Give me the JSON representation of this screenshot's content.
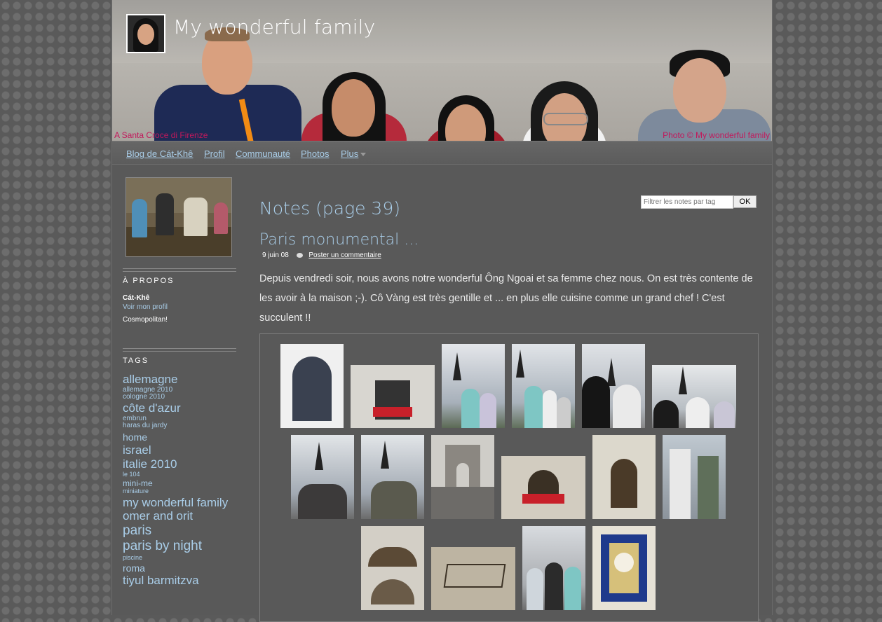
{
  "header": {
    "site_title": "My wonderful family",
    "caption_left": "A Santa Croce di Firenze",
    "caption_right": "Photo © My wonderful family"
  },
  "nav": {
    "items": [
      {
        "label": "Blog de Cát-Khê"
      },
      {
        "label": "Profil"
      },
      {
        "label": "Communauté"
      },
      {
        "label": "Photos"
      },
      {
        "label": "Plus"
      }
    ]
  },
  "sidebar": {
    "about_heading": "À PROPOS",
    "profile_name": "Cát-Khê",
    "profile_link": "Voir mon profil",
    "profile_status": "Cosmopolitan!",
    "tags_heading": "TAGS",
    "tags": [
      {
        "label": "allemagne",
        "size": "large"
      },
      {
        "label": "allemagne 2010",
        "size": "small"
      },
      {
        "label": "cologne 2010",
        "size": "small"
      },
      {
        "label": "côte d'azur",
        "size": "large"
      },
      {
        "label": "embrun",
        "size": "small"
      },
      {
        "label": "haras du jardy",
        "size": "small"
      },
      {
        "label": "home",
        "size": "medium"
      },
      {
        "label": "israel",
        "size": "large"
      },
      {
        "label": "italie 2010",
        "size": "large"
      },
      {
        "label": "le 104",
        "size": "tiny"
      },
      {
        "label": "mini-me",
        "size": "small-medium"
      },
      {
        "label": "miniature",
        "size": "tiny"
      },
      {
        "label": "my wonderful family",
        "size": "large"
      },
      {
        "label": "omer and orit",
        "size": "large"
      },
      {
        "label": "paris",
        "size": "xlarge"
      },
      {
        "label": "paris by night",
        "size": "xlarge"
      },
      {
        "label": "piscine",
        "size": "tiny"
      },
      {
        "label": "roma",
        "size": "medium"
      },
      {
        "label": "tiyul barmitzva",
        "size": "large"
      }
    ]
  },
  "main": {
    "heading": "Notes (page 39)",
    "filter_placeholder": "Filtrer les notes par tag",
    "ok_label": "OK",
    "post": {
      "title": "Paris monumental ...",
      "date": "9 juin 08",
      "comment_link": "Poster un commentaire",
      "body": "Depuis vendredi soir, nous avons notre wonderful Ông Ngoai et sa femme chez nous. On est très contente de les avoir à la maison ;-). Cô Vàng est très gentille et ... en plus elle cuisine comme un grand chef ! C'est succulent !!"
    }
  },
  "colors": {
    "link": "#a9cde8",
    "caption": "#c2185b",
    "page_bg": "#595959"
  }
}
